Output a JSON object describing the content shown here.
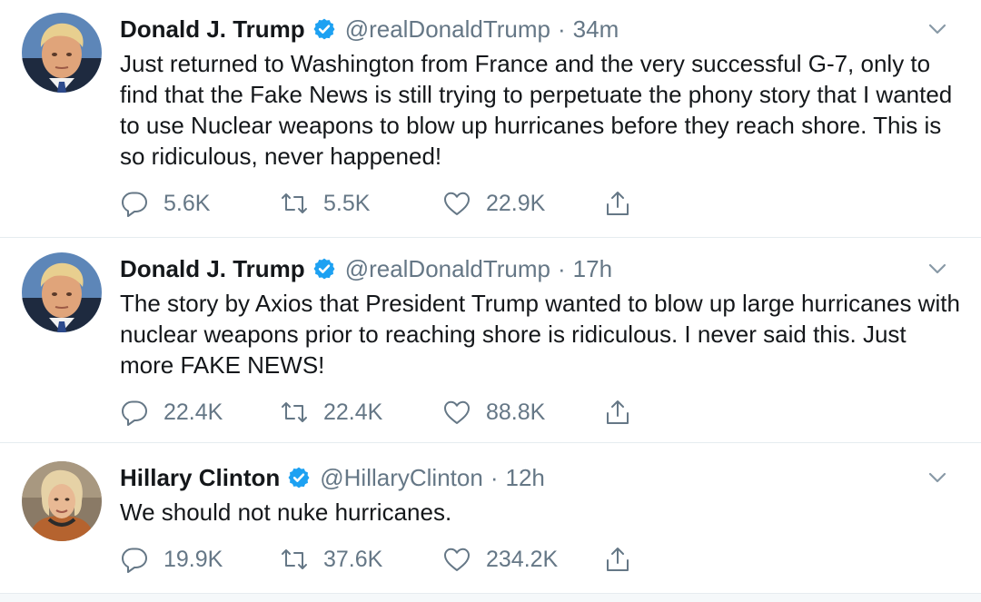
{
  "colors": {
    "text": "#14171a",
    "muted": "#657786",
    "verified": "#1da1f2",
    "divider": "#e6ecf0"
  },
  "tweets": [
    {
      "author": "Donald J. Trump",
      "handle": "@realDonaldTrump",
      "separator": "·",
      "time": "34m",
      "verified": true,
      "avatar_icon": "trump-portrait",
      "text": "Just returned to Washington from France and the very successful G-7, only to find that the Fake News is still trying to perpetuate the phony story that I wanted to use Nuclear weapons to blow up hurricanes before they reach shore. This is so ridiculous, never happened!",
      "replies": "5.6K",
      "retweets": "5.5K",
      "likes": "22.9K"
    },
    {
      "author": "Donald J. Trump",
      "handle": "@realDonaldTrump",
      "separator": "·",
      "time": "17h",
      "verified": true,
      "avatar_icon": "trump-portrait",
      "text": "The story by Axios that President Trump wanted to blow up large hurricanes with nuclear weapons prior to reaching shore is ridiculous. I never said this. Just more FAKE NEWS!",
      "replies": "22.4K",
      "retweets": "22.4K",
      "likes": "88.8K"
    },
    {
      "author": "Hillary Clinton",
      "handle": "@HillaryClinton",
      "separator": "·",
      "time": "12h",
      "verified": true,
      "avatar_icon": "clinton-portrait",
      "text": "We should not nuke hurricanes.",
      "replies": "19.9K",
      "retweets": "37.6K",
      "likes": "234.2K"
    }
  ]
}
